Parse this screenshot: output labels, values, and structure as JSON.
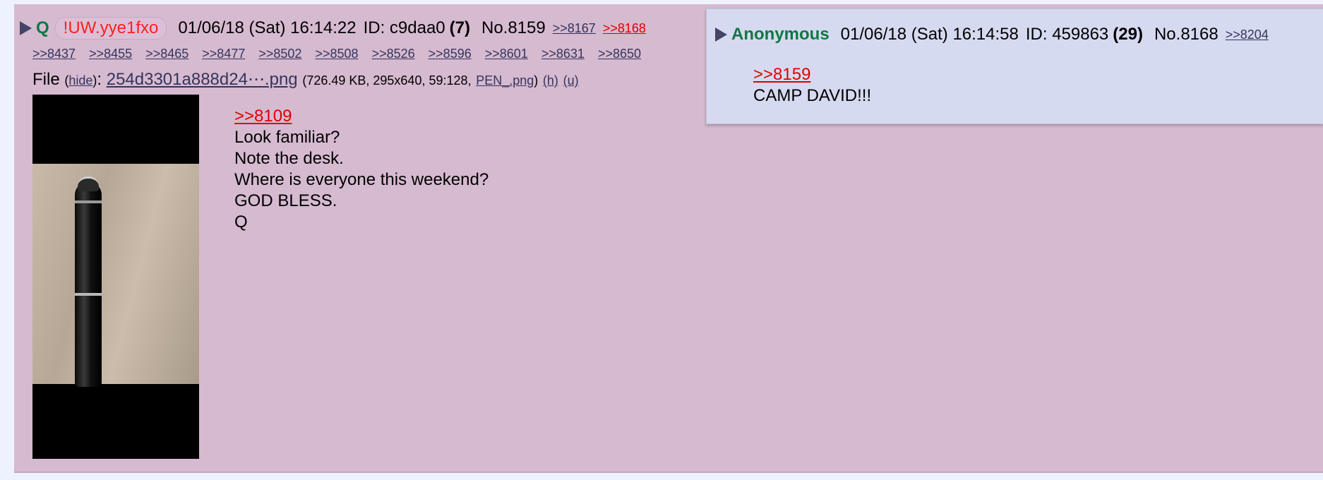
{
  "post": {
    "name": "Q",
    "tripcode": "!UW.yye1fxo",
    "datetime": "01/06/18 (Sat) 16:14:22",
    "id_label": "ID: c9daa0",
    "id_count": "(7)",
    "number": "No.8159",
    "header_replies": [
      ">>8167",
      ">>8168"
    ],
    "backlinks": [
      ">>8437",
      ">>8455",
      ">>8465",
      ">>8477",
      ">>8502",
      ">>8508",
      ">>8526",
      ">>8596",
      ">>8601",
      ">>8631",
      ">>8650"
    ],
    "file": {
      "label": "File",
      "hide": "hide",
      "filename": "254d3301a888d24⋯.png",
      "details_prefix": "(726.49 KB, 295x640, 59:128,",
      "original_name": "PEN_.png",
      "details_suffix": ")",
      "h_link": "(h)",
      "u_link": "(u)"
    },
    "comment": {
      "quote": ">>8109",
      "lines": [
        "Look familiar?",
        "Note the desk.",
        "Where is everyone this weekend?",
        "GOD BLESS.",
        "Q"
      ]
    }
  },
  "preview": {
    "name": "Anonymous",
    "datetime": "01/06/18 (Sat) 16:14:58",
    "id_label": "ID: 459863",
    "id_count": "(29)",
    "number": "No.8168",
    "reply_link": ">>8204",
    "quote": ">>8159",
    "text": "CAMP DAVID!!!"
  },
  "colors": {
    "post_bg": "#d6bad0",
    "preview_bg": "#d6daf0",
    "name": "#117743",
    "trip": "#ff2020",
    "quote_link": "#e00000",
    "link": "#34345c"
  },
  "icons": {
    "toggle": "triangle-right-icon"
  }
}
